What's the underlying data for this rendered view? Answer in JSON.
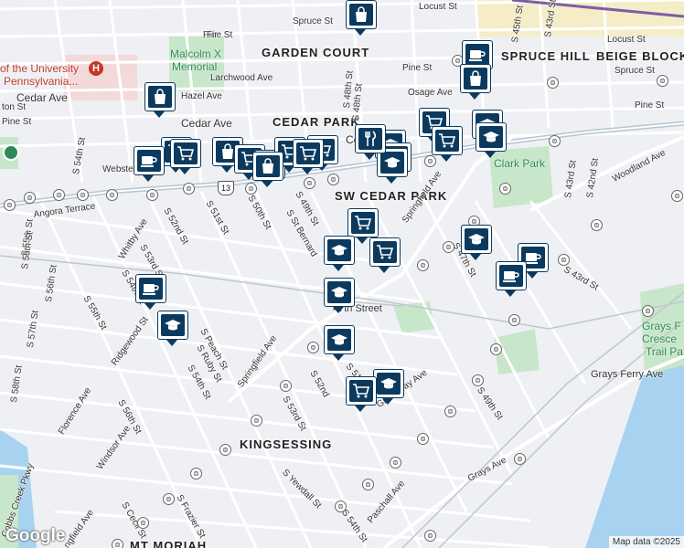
{
  "map": {
    "neighborhoods": [
      {
        "name": "GARDEN COURT"
      },
      {
        "name": "CEDAR PARK"
      },
      {
        "name": "SW CEDAR PARK"
      },
      {
        "name": "KINGSESSING"
      },
      {
        "name": "SPRUCE HILL"
      },
      {
        "name": "BEIGE BLOCK"
      },
      {
        "name": "MT MORIAH"
      }
    ],
    "pois": [
      {
        "name": "Malcolm X",
        "color": "#2e8b57"
      },
      {
        "name": "Memorial",
        "color": "#2e8b57"
      },
      {
        "name": "Clark Park",
        "color": "#2e8b57"
      },
      {
        "name": "of the University",
        "color": "#c0392b"
      },
      {
        "name": "Pennsylvania...",
        "color": "#c0392b"
      },
      {
        "name": "Grays F",
        "color": "#2e8b57"
      },
      {
        "name": "Cresce",
        "color": "#2e8b57"
      },
      {
        "name": "Trail Pa",
        "color": "#2e8b57"
      }
    ],
    "streets": [
      "Spruce St",
      "Locust St",
      "S 45th St",
      "S 43rd St",
      "Pine St",
      "Locust St",
      "Spruce St",
      "Pine St",
      "Larchwood Ave",
      "Osage Ave",
      "Hazel Ave",
      "Cedar Ave",
      "Cedar Ave",
      "Webster St",
      "S 54th St",
      "S 51st St",
      "S 50th St",
      "S 49th St",
      "S St Bernard",
      "S 48th St",
      "Springfield Ave",
      "S 47th St",
      "S 43rd St",
      "S 42nd St",
      "Woodland Ave",
      "S 43rd St",
      "Angora Terrace",
      "Whitby Ave",
      "S 52nd St",
      "S 53rd St",
      "S 55th St",
      "S 56th St",
      "S 54th St",
      "S 55th St",
      "Ridgewood St",
      "S 57th St",
      "S 58th St",
      "Florence Ave",
      "S 56th St",
      "Windsor Ave",
      "S Peach St",
      "S Ruby St",
      "S 54th St",
      "Springfield Ave",
      "S 53rd St",
      "S 52nd",
      "S 51st St",
      "Greenway Ave",
      "47th Street",
      "Grays Ferry Ave",
      "S 49th St",
      "Grays Ave",
      "S Yewdall St",
      "S 54th St",
      "Paschall Ave",
      "S Cecil St",
      "S Frazier St",
      "Cobbs Creek Pkwy",
      "ngfield Ave",
      "Pine St",
      "Cedar Ave",
      "ton St",
      "Pine St",
      "Fir",
      "S 55th St",
      "S 48th St"
    ],
    "highway_shield": "13",
    "transit_glyph": "⊜",
    "markers": [
      {
        "icon": "shopping-bag-icon"
      },
      {
        "icon": "coffee-cup-icon"
      },
      {
        "icon": "shopping-bag-icon"
      },
      {
        "icon": "shopping-bag-icon"
      },
      {
        "icon": "shopping-cart-icon"
      },
      {
        "icon": "coffee-cup-icon"
      },
      {
        "icon": "shopping-cart-icon"
      },
      {
        "icon": "shopping-bag-icon"
      },
      {
        "icon": "shopping-cart-icon"
      },
      {
        "icon": "shopping-bag-icon"
      },
      {
        "icon": "shopping-cart-icon"
      },
      {
        "icon": "graduation-cap-icon"
      },
      {
        "icon": "shopping-cart-icon"
      },
      {
        "icon": "graduation-cap-icon"
      },
      {
        "icon": "graduation-cap-icon"
      },
      {
        "icon": "graduation-cap-icon"
      },
      {
        "icon": "shopping-cart-icon"
      },
      {
        "icon": "graduation-cap-icon"
      },
      {
        "icon": "fork-knife-icon"
      },
      {
        "icon": "shopping-cart-icon"
      },
      {
        "icon": "graduation-cap-icon"
      },
      {
        "icon": "graduation-cap-icon"
      },
      {
        "icon": "coffee-cup-icon"
      },
      {
        "icon": "coffee-cup-icon"
      },
      {
        "icon": "graduation-cap-icon"
      },
      {
        "icon": "coffee-cup-icon"
      },
      {
        "icon": "shopping-bag-icon"
      },
      {
        "icon": "graduation-cap-icon"
      }
    ],
    "logo": "Google",
    "attribution": "Map data ©2025"
  }
}
